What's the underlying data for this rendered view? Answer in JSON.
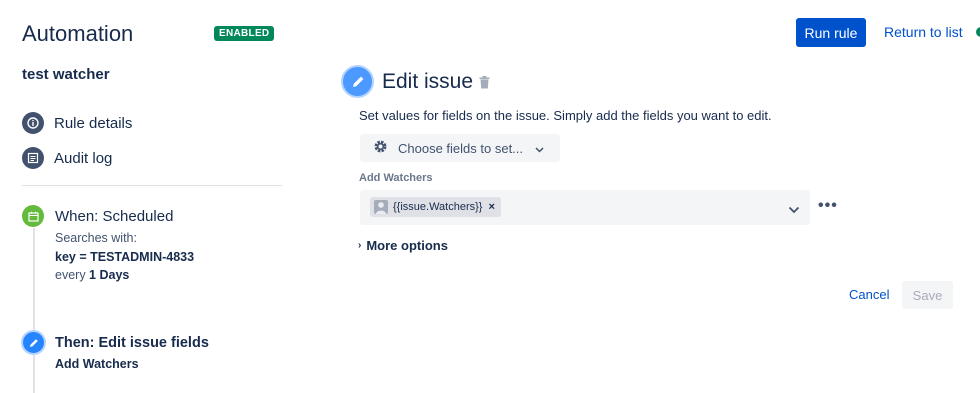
{
  "header": {
    "app_title": "Automation",
    "status_badge": "ENABLED",
    "run_rule_label": "Run rule",
    "return_link": "Return to list"
  },
  "sidebar": {
    "rule_name": "test watcher",
    "nav": [
      {
        "label": "Rule details",
        "icon": "info-icon"
      },
      {
        "label": "Audit log",
        "icon": "list-icon"
      }
    ],
    "trigger": {
      "title": "When: Scheduled",
      "searches_with": "Searches with:",
      "key_prefix": "key = ",
      "key_value": "TESTADMIN-4833",
      "every_prefix": "every ",
      "every_value": "1 Days",
      "icon": "calendar-icon"
    },
    "action": {
      "title": "Then: Edit issue fields",
      "subtitle": "Add Watchers",
      "icon": "pencil-icon"
    }
  },
  "editor": {
    "title": "Edit issue",
    "description": "Set values for fields on the issue. Simply add the fields you want to edit.",
    "choose_fields_label": "Choose fields to set...",
    "field_label": "Add Watchers",
    "watchers_chip": "{{issue.Watchers}}",
    "more_options": "More options",
    "cancel_label": "Cancel",
    "save_label": "Save"
  },
  "colors": {
    "primary": "#0052cc",
    "enabled": "#00875a",
    "trigger_green": "#63ba3c",
    "action_blue": "#2684ff"
  }
}
